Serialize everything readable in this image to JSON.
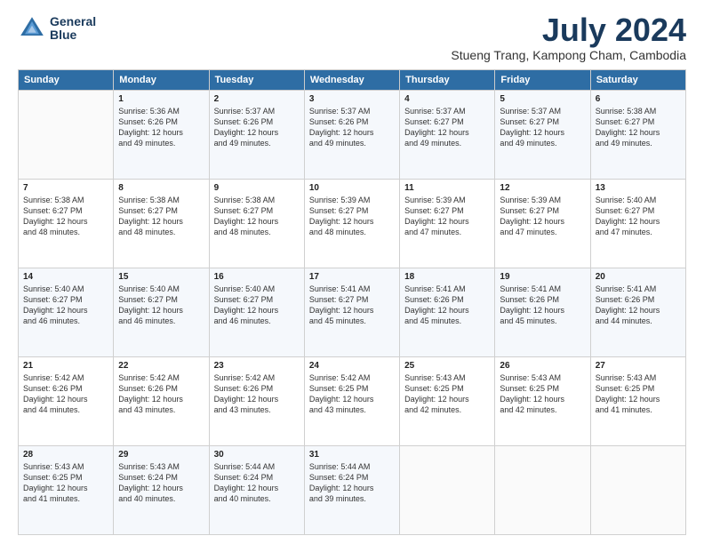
{
  "header": {
    "logo_line1": "General",
    "logo_line2": "Blue",
    "title": "July 2024",
    "location": "Stueng Trang, Kampong Cham, Cambodia"
  },
  "weekdays": [
    "Sunday",
    "Monday",
    "Tuesday",
    "Wednesday",
    "Thursday",
    "Friday",
    "Saturday"
  ],
  "weeks": [
    [
      {
        "day": "",
        "info": ""
      },
      {
        "day": "1",
        "info": "Sunrise: 5:36 AM\nSunset: 6:26 PM\nDaylight: 12 hours\nand 49 minutes."
      },
      {
        "day": "2",
        "info": "Sunrise: 5:37 AM\nSunset: 6:26 PM\nDaylight: 12 hours\nand 49 minutes."
      },
      {
        "day": "3",
        "info": "Sunrise: 5:37 AM\nSunset: 6:26 PM\nDaylight: 12 hours\nand 49 minutes."
      },
      {
        "day": "4",
        "info": "Sunrise: 5:37 AM\nSunset: 6:27 PM\nDaylight: 12 hours\nand 49 minutes."
      },
      {
        "day": "5",
        "info": "Sunrise: 5:37 AM\nSunset: 6:27 PM\nDaylight: 12 hours\nand 49 minutes."
      },
      {
        "day": "6",
        "info": "Sunrise: 5:38 AM\nSunset: 6:27 PM\nDaylight: 12 hours\nand 49 minutes."
      }
    ],
    [
      {
        "day": "7",
        "info": "Sunrise: 5:38 AM\nSunset: 6:27 PM\nDaylight: 12 hours\nand 48 minutes."
      },
      {
        "day": "8",
        "info": "Sunrise: 5:38 AM\nSunset: 6:27 PM\nDaylight: 12 hours\nand 48 minutes."
      },
      {
        "day": "9",
        "info": "Sunrise: 5:38 AM\nSunset: 6:27 PM\nDaylight: 12 hours\nand 48 minutes."
      },
      {
        "day": "10",
        "info": "Sunrise: 5:39 AM\nSunset: 6:27 PM\nDaylight: 12 hours\nand 48 minutes."
      },
      {
        "day": "11",
        "info": "Sunrise: 5:39 AM\nSunset: 6:27 PM\nDaylight: 12 hours\nand 47 minutes."
      },
      {
        "day": "12",
        "info": "Sunrise: 5:39 AM\nSunset: 6:27 PM\nDaylight: 12 hours\nand 47 minutes."
      },
      {
        "day": "13",
        "info": "Sunrise: 5:40 AM\nSunset: 6:27 PM\nDaylight: 12 hours\nand 47 minutes."
      }
    ],
    [
      {
        "day": "14",
        "info": "Sunrise: 5:40 AM\nSunset: 6:27 PM\nDaylight: 12 hours\nand 46 minutes."
      },
      {
        "day": "15",
        "info": "Sunrise: 5:40 AM\nSunset: 6:27 PM\nDaylight: 12 hours\nand 46 minutes."
      },
      {
        "day": "16",
        "info": "Sunrise: 5:40 AM\nSunset: 6:27 PM\nDaylight: 12 hours\nand 46 minutes."
      },
      {
        "day": "17",
        "info": "Sunrise: 5:41 AM\nSunset: 6:27 PM\nDaylight: 12 hours\nand 45 minutes."
      },
      {
        "day": "18",
        "info": "Sunrise: 5:41 AM\nSunset: 6:26 PM\nDaylight: 12 hours\nand 45 minutes."
      },
      {
        "day": "19",
        "info": "Sunrise: 5:41 AM\nSunset: 6:26 PM\nDaylight: 12 hours\nand 45 minutes."
      },
      {
        "day": "20",
        "info": "Sunrise: 5:41 AM\nSunset: 6:26 PM\nDaylight: 12 hours\nand 44 minutes."
      }
    ],
    [
      {
        "day": "21",
        "info": "Sunrise: 5:42 AM\nSunset: 6:26 PM\nDaylight: 12 hours\nand 44 minutes."
      },
      {
        "day": "22",
        "info": "Sunrise: 5:42 AM\nSunset: 6:26 PM\nDaylight: 12 hours\nand 43 minutes."
      },
      {
        "day": "23",
        "info": "Sunrise: 5:42 AM\nSunset: 6:26 PM\nDaylight: 12 hours\nand 43 minutes."
      },
      {
        "day": "24",
        "info": "Sunrise: 5:42 AM\nSunset: 6:25 PM\nDaylight: 12 hours\nand 43 minutes."
      },
      {
        "day": "25",
        "info": "Sunrise: 5:43 AM\nSunset: 6:25 PM\nDaylight: 12 hours\nand 42 minutes."
      },
      {
        "day": "26",
        "info": "Sunrise: 5:43 AM\nSunset: 6:25 PM\nDaylight: 12 hours\nand 42 minutes."
      },
      {
        "day": "27",
        "info": "Sunrise: 5:43 AM\nSunset: 6:25 PM\nDaylight: 12 hours\nand 41 minutes."
      }
    ],
    [
      {
        "day": "28",
        "info": "Sunrise: 5:43 AM\nSunset: 6:25 PM\nDaylight: 12 hours\nand 41 minutes."
      },
      {
        "day": "29",
        "info": "Sunrise: 5:43 AM\nSunset: 6:24 PM\nDaylight: 12 hours\nand 40 minutes."
      },
      {
        "day": "30",
        "info": "Sunrise: 5:44 AM\nSunset: 6:24 PM\nDaylight: 12 hours\nand 40 minutes."
      },
      {
        "day": "31",
        "info": "Sunrise: 5:44 AM\nSunset: 6:24 PM\nDaylight: 12 hours\nand 39 minutes."
      },
      {
        "day": "",
        "info": ""
      },
      {
        "day": "",
        "info": ""
      },
      {
        "day": "",
        "info": ""
      }
    ]
  ]
}
